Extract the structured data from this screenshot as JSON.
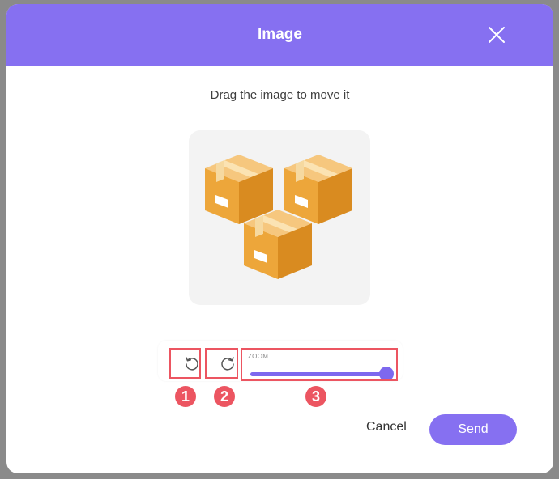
{
  "modal": {
    "title": "Image",
    "instruction": "Drag the image to move it"
  },
  "toolbar": {
    "rotate_left_icon": "rotate-counterclockwise-icon",
    "rotate_right_icon": "rotate-clockwise-icon",
    "zoom": {
      "label": "ZOOM",
      "value": 1.0
    }
  },
  "annotations": [
    "1",
    "2",
    "3"
  ],
  "footer": {
    "cancel_label": "Cancel",
    "send_label": "Send"
  },
  "colors": {
    "accent": "#8670f1",
    "highlight": "#ec5561",
    "box": "#eda63a"
  }
}
